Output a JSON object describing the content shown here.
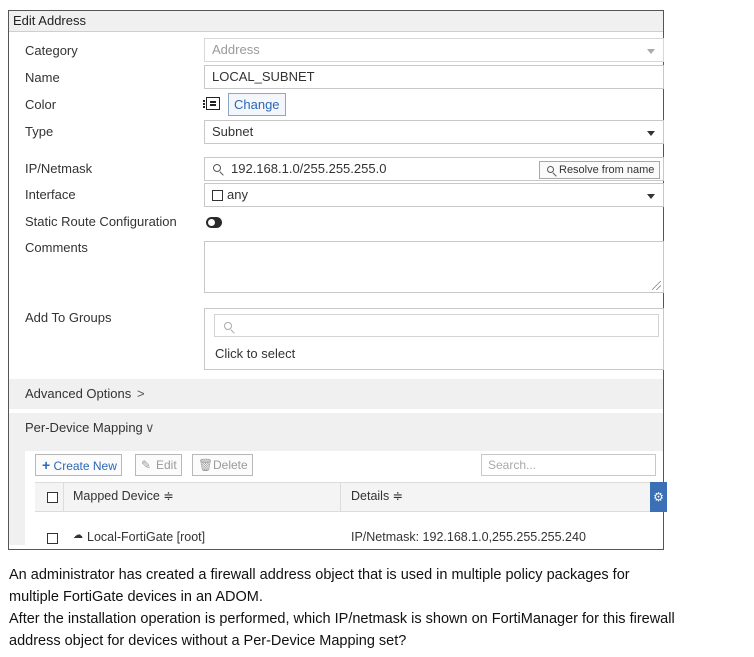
{
  "dialog": {
    "title": "Edit Address"
  },
  "form": {
    "category": {
      "label": "Category",
      "value": "Address"
    },
    "name": {
      "label": "Name",
      "value": "LOCAL_SUBNET"
    },
    "color": {
      "label": "Color",
      "button": "Change"
    },
    "type": {
      "label": "Type",
      "value": "Subnet"
    },
    "ip_netmask": {
      "label": "IP/Netmask",
      "value": "192.168.1.0/255.255.255.0",
      "resolve_button": "Resolve from name"
    },
    "interface": {
      "label": "Interface",
      "value": "any"
    },
    "static_route": {
      "label": "Static Route Configuration",
      "enabled": false
    },
    "comments": {
      "label": "Comments",
      "value": ""
    },
    "groups": {
      "label": "Add To Groups",
      "placeholder": "Click to select"
    }
  },
  "sections": {
    "advanced": {
      "label": "Advanced Options",
      "arrow": ">"
    },
    "mapping": {
      "label": "Per-Device Mapping",
      "arrow": "∨"
    }
  },
  "mapping_toolbar": {
    "create": "Create New",
    "edit": "Edit",
    "delete": "Delete",
    "search_placeholder": "Search..."
  },
  "mapping_table": {
    "columns": [
      "Mapped Device ≑",
      "Details ≑"
    ],
    "rows": [
      {
        "device": "Local-FortiGate [root]",
        "details": "IP/Netmask: 192.168.1.0,255.255.255.240"
      }
    ]
  },
  "question": {
    "line1": "An administrator has created a firewall address object that is used in multiple policy packages for",
    "line2": "multiple FortiGate devices in an ADOM.",
    "line3": "After the installation operation is performed, which IP/netmask is shown on FortiManager for this firewall",
    "line4": "address object for devices without a Per-Device Mapping set?"
  },
  "colors": {
    "accent": "#2b67b8",
    "gear_bg": "#3b6fb6"
  }
}
